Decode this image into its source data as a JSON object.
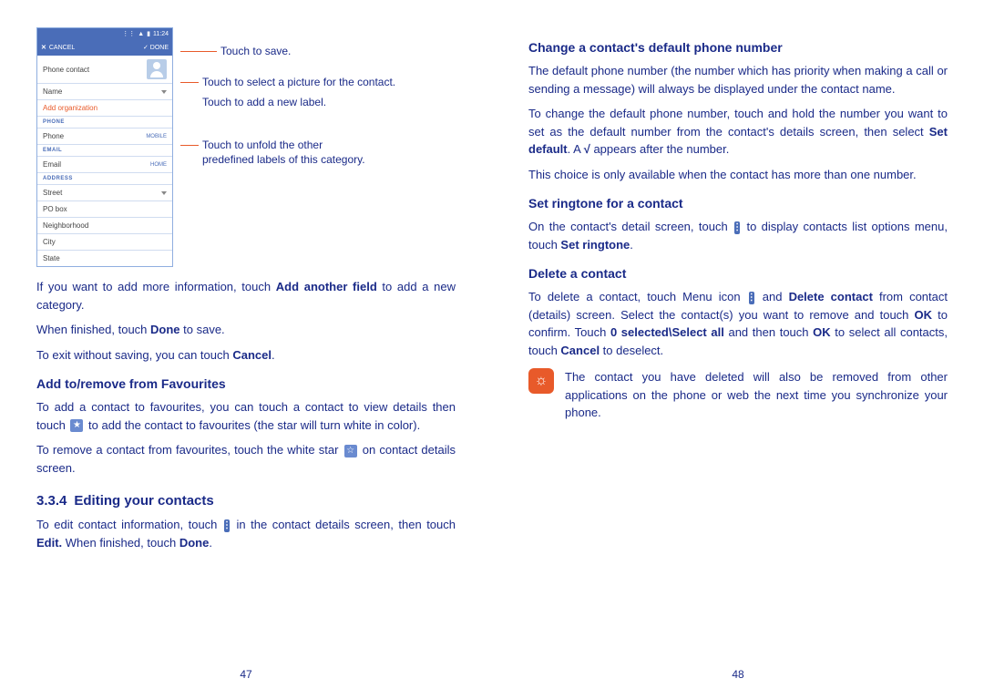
{
  "left": {
    "phone": {
      "status_time": "11:24",
      "cancel": "CANCEL",
      "done": "DONE",
      "phone_contact": "Phone contact",
      "name": "Name",
      "add_org": "Add organization",
      "section_phone": "PHONE",
      "phone_field": "Phone",
      "mobile": "MOBILE",
      "section_email": "EMAIL",
      "email_field": "Email",
      "home": "HOME",
      "section_address": "ADDRESS",
      "street": "Street",
      "pobox": "PO box",
      "neigh": "Neighborhood",
      "city": "City",
      "state": "State"
    },
    "callouts": {
      "save": "Touch to save.",
      "picture": "Touch to select a picture for the contact.",
      "label": "Touch to add a new label.",
      "unfold1": "Touch to unfold the other",
      "unfold2": "predefined labels of this category."
    },
    "p1a": "If you want to add more information, touch ",
    "p1b": "Add another field",
    "p1c": " to add a new category.",
    "p2a": "When finished, touch ",
    "p2b": "Done",
    "p2c": " to save.",
    "p3a": "To exit without saving, you can touch ",
    "p3b": "Cancel",
    "p3c": ".",
    "h_fav": "Add to/remove from Favourites",
    "p4a": "To add a contact to favourites, you can touch a contact to view details then touch ",
    "p4b": " to add the contact to favourites (the star will turn white in color).",
    "p5a": "To remove a contact from favourites, touch the white star ",
    "p5b": " on contact details screen.",
    "h_edit_num": "3.3.4",
    "h_edit": "Editing your contacts",
    "p6a": "To edit contact information, touch ",
    "p6b": " in the contact details screen, then touch ",
    "p6c": "Edit.",
    "p6d": " When finished, touch ",
    "p6e": "Done",
    "p6f": ".",
    "pagenum": "47"
  },
  "right": {
    "h_default": "Change a contact's default phone number",
    "p1": "The default phone number (the number which has priority when making a call or sending a message) will always be displayed under the contact name.",
    "p2a": "To change the default phone number, touch and hold the number you want to set as the default number from the contact's details screen, then select ",
    "p2b": "Set default",
    "p2c": ". A ",
    "p2d": " appears after the number.",
    "p3": "This choice is only available when the contact has more than one number.",
    "h_ring": "Set ringtone for a contact",
    "p4a": "On the contact's detail screen, touch ",
    "p4b": " to display contacts list options menu, touch ",
    "p4c": "Set ringtone",
    "p4d": ".",
    "h_delete": "Delete a contact",
    "p5a": "To delete a contact, touch Menu icon ",
    "p5b": " and ",
    "p5c": "Delete contact",
    "p5d": " from contact (details) screen. Select the contact(s) you want to remove and touch ",
    "p5e": "OK",
    "p5f": " to confirm. Touch ",
    "p5g": "0 selected\\Select all",
    "p5h": " and then touch ",
    "p5i": "OK",
    "p5j": " to select all contacts, touch ",
    "p5k": "Cancel",
    "p5l": " to deselect.",
    "tip": "The contact you have deleted will also be removed from other applications on the phone or web the next time you synchronize your phone.",
    "pagenum": "48"
  }
}
